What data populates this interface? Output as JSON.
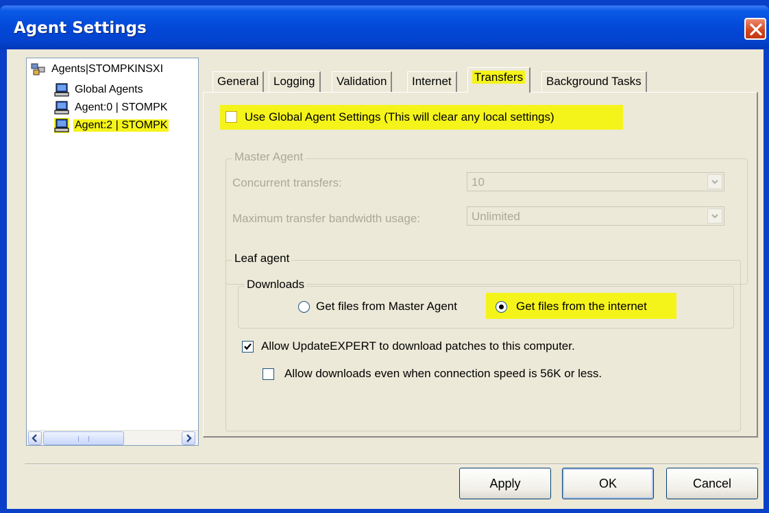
{
  "window": {
    "title": "Agent Settings",
    "close_icon": "close-icon"
  },
  "tree": {
    "root": {
      "label": "Agents|STOMPKINSXI",
      "icon": "agents-group-icon"
    },
    "items": [
      {
        "label": "Global Agents",
        "icon": "computer-icon"
      },
      {
        "label": "Agent:0 | STOMPK",
        "icon": "computer-icon"
      },
      {
        "label": "Agent:2 | STOMPK",
        "icon": "computer-icon",
        "selected": true
      }
    ]
  },
  "tabs": [
    {
      "label": "General"
    },
    {
      "label": "Logging"
    },
    {
      "label": "Validation"
    },
    {
      "label": "Internet"
    },
    {
      "label": "Transfers",
      "active": true
    },
    {
      "label": "Background Tasks"
    }
  ],
  "transfers": {
    "use_global_label": "Use Global Agent Settings (This will clear any local settings)",
    "use_global_checked": false,
    "master_agent": {
      "title": "Master Agent",
      "concurrent_label": "Concurrent transfers:",
      "concurrent_value": "10",
      "bandwidth_label": "Maximum transfer bandwidth usage:",
      "bandwidth_value": "Unlimited"
    },
    "leaf_agent": {
      "title": "Leaf agent",
      "downloads": {
        "title": "Downloads",
        "option_master": "Get files from Master Agent",
        "option_internet": "Get files from the internet",
        "selected": "internet"
      },
      "allow_download_label": "Allow UpdateEXPERT to download patches to this computer.",
      "allow_download_checked": true,
      "allow_slow_label": "Allow downloads even when connection speed is 56K or less.",
      "allow_slow_checked": false
    }
  },
  "buttons": {
    "apply": "Apply",
    "ok": "OK",
    "cancel": "Cancel"
  },
  "colors": {
    "highlight": "#f5f41a",
    "title_bar": "#0348d8",
    "dialog_bg": "#ece9d8"
  }
}
